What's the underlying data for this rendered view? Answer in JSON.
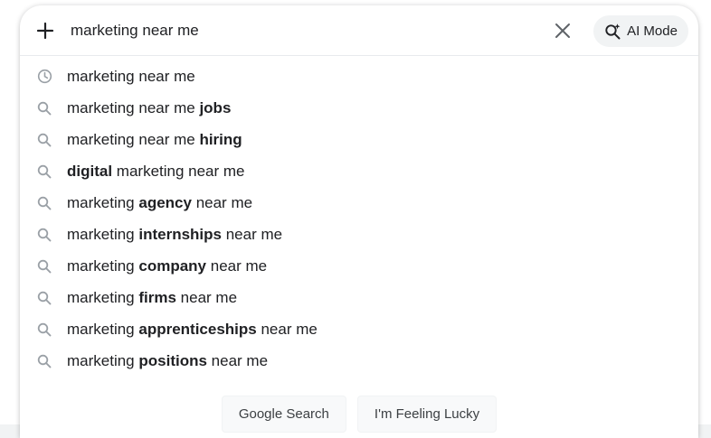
{
  "search": {
    "query": "marketing near me",
    "ai_mode_label": "AI Mode"
  },
  "suggestions": [
    {
      "icon": "history-clock-icon",
      "parts": [
        {
          "t": "marketing near me",
          "b": false
        }
      ]
    },
    {
      "icon": "search-icon",
      "parts": [
        {
          "t": "marketing near me ",
          "b": false
        },
        {
          "t": "jobs",
          "b": true
        }
      ]
    },
    {
      "icon": "search-icon",
      "parts": [
        {
          "t": "marketing near me ",
          "b": false
        },
        {
          "t": "hiring",
          "b": true
        }
      ]
    },
    {
      "icon": "search-icon",
      "parts": [
        {
          "t": "digital",
          "b": true
        },
        {
          "t": " marketing near me",
          "b": false
        }
      ]
    },
    {
      "icon": "search-icon",
      "parts": [
        {
          "t": "marketing ",
          "b": false
        },
        {
          "t": "agency",
          "b": true
        },
        {
          "t": " near me",
          "b": false
        }
      ]
    },
    {
      "icon": "search-icon",
      "parts": [
        {
          "t": "marketing ",
          "b": false
        },
        {
          "t": "internships",
          "b": true
        },
        {
          "t": " near me",
          "b": false
        }
      ]
    },
    {
      "icon": "search-icon",
      "parts": [
        {
          "t": "marketing ",
          "b": false
        },
        {
          "t": "company",
          "b": true
        },
        {
          "t": " near me",
          "b": false
        }
      ]
    },
    {
      "icon": "search-icon",
      "parts": [
        {
          "t": "marketing ",
          "b": false
        },
        {
          "t": "firms",
          "b": true
        },
        {
          "t": " near me",
          "b": false
        }
      ]
    },
    {
      "icon": "search-icon",
      "parts": [
        {
          "t": "marketing ",
          "b": false
        },
        {
          "t": "apprenticeships",
          "b": true
        },
        {
          "t": " near me",
          "b": false
        }
      ]
    },
    {
      "icon": "search-icon",
      "parts": [
        {
          "t": "marketing ",
          "b": false
        },
        {
          "t": "positions",
          "b": true
        },
        {
          "t": " near me",
          "b": false
        }
      ]
    }
  ],
  "buttons": {
    "google_search": "Google Search",
    "feeling_lucky": "I'm Feeling Lucky"
  }
}
